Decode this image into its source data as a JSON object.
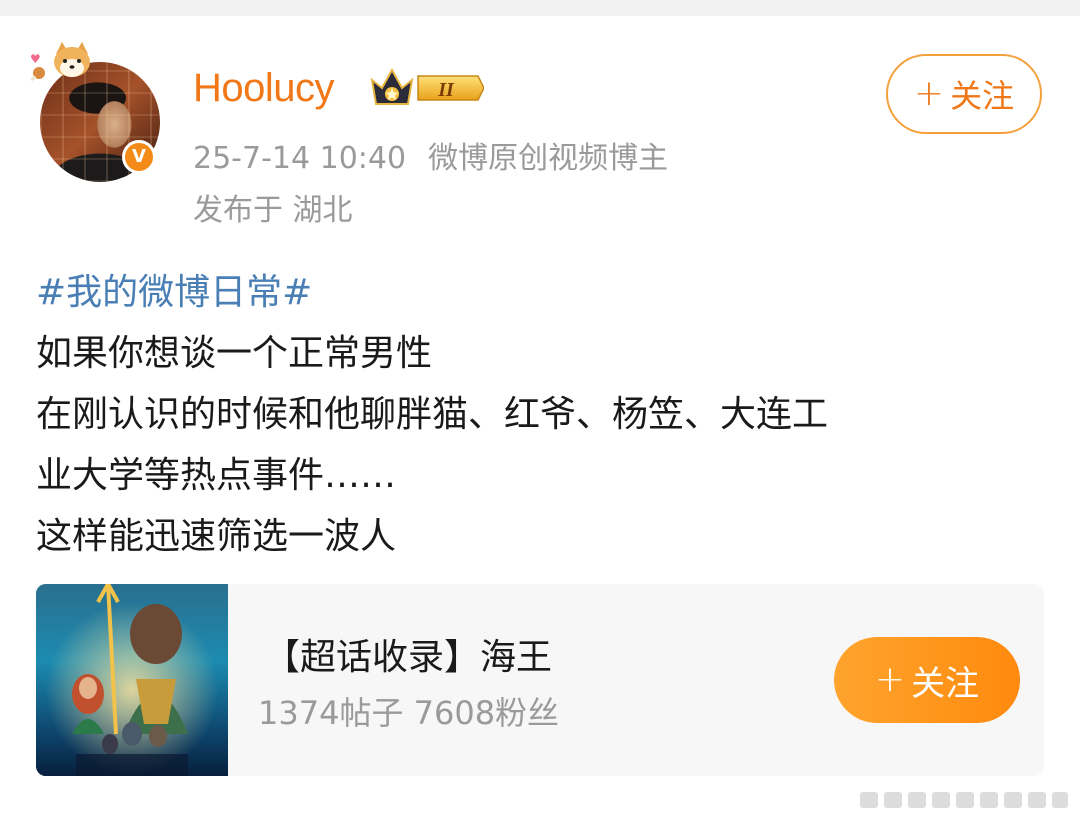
{
  "author": {
    "name": "Hoolucy",
    "timestamp": "25-7-14 10:40",
    "source": "微博原创视频博主",
    "location": "发布于 湖北",
    "verified_icon": "v-verified-icon",
    "level_badge": "II"
  },
  "follow_button": {
    "label": "关注",
    "plus": "+"
  },
  "post": {
    "topic": "#我的微博日常#",
    "lines": [
      "如果你想谈一个正常男性",
      "在刚认识的时候和他聊胖猫、红爷、杨笠、大连工",
      "业大学等热点事件……",
      "这样能迅速筛选一波人"
    ]
  },
  "super_topic_card": {
    "title": "【超话收录】海王",
    "stats": "1374帖子 7608粉丝",
    "follow_label": "关注",
    "plus": "+"
  },
  "colors": {
    "accent": "#f07818",
    "topic_link": "#4a7fb5",
    "meta_gray": "#9a9a9a",
    "card_bg": "#f7f7f7"
  }
}
